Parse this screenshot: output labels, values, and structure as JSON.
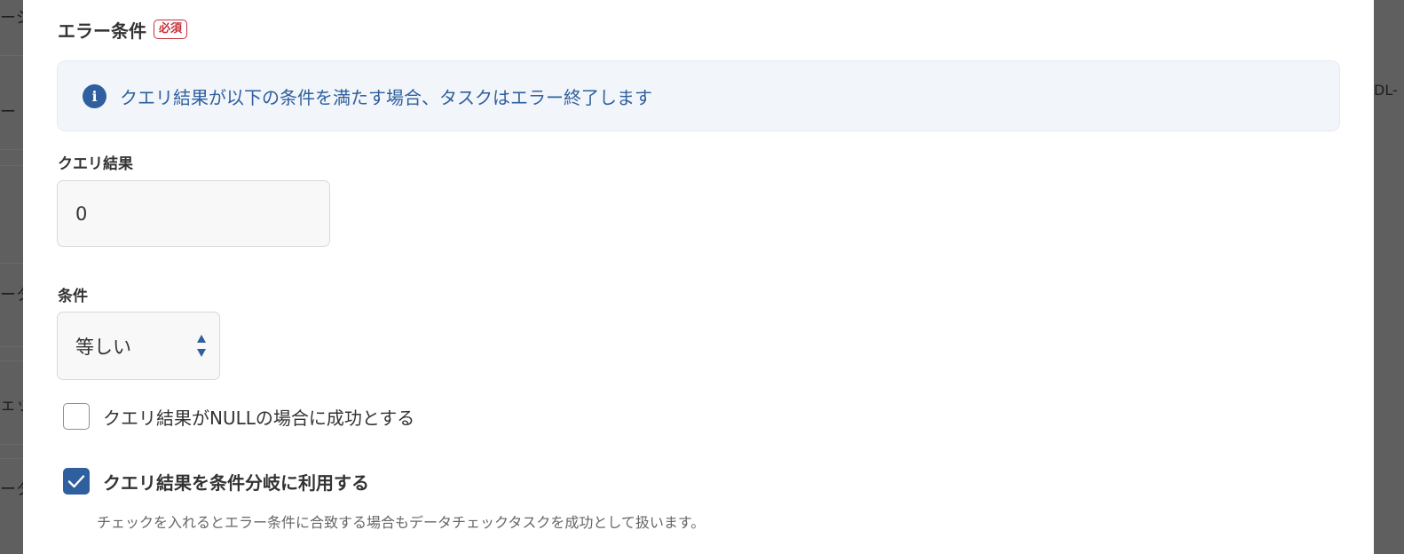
{
  "background": {
    "left_fragments": [
      "ーシ",
      "ー",
      "ータ",
      "ェック",
      "ータ"
    ],
    "right_fragment": "DL-"
  },
  "section": {
    "title": "エラー条件",
    "required_badge": "必須"
  },
  "info": {
    "icon": "info-icon",
    "message": "クエリ結果が以下の条件を満たす場合、タスクはエラー終了します"
  },
  "query_result": {
    "label": "クエリ結果",
    "value": "0"
  },
  "condition": {
    "label": "条件",
    "selected": "等しい"
  },
  "checkboxes": [
    {
      "label": "クエリ結果がNULLの場合に成功とする",
      "checked": false
    },
    {
      "label": "クエリ結果を条件分岐に利用する",
      "checked": true
    }
  ],
  "help_text": "チェックを入れるとエラー条件に合致する場合もデータチェックタスクを成功として扱います。",
  "colors": {
    "accent": "#2f5f9e",
    "required": "#c5303a",
    "info_background": "#f2f6fa"
  }
}
